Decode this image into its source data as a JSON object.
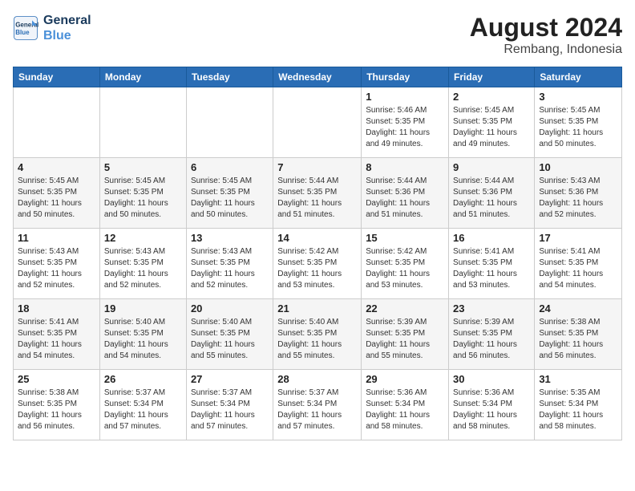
{
  "logo": {
    "line1": "General",
    "line2": "Blue"
  },
  "title": "August 2024",
  "subtitle": "Rembang, Indonesia",
  "days_of_week": [
    "Sunday",
    "Monday",
    "Tuesday",
    "Wednesday",
    "Thursday",
    "Friday",
    "Saturday"
  ],
  "weeks": [
    [
      {
        "day": "",
        "info": ""
      },
      {
        "day": "",
        "info": ""
      },
      {
        "day": "",
        "info": ""
      },
      {
        "day": "",
        "info": ""
      },
      {
        "day": "1",
        "info": "Sunrise: 5:46 AM\nSunset: 5:35 PM\nDaylight: 11 hours\nand 49 minutes."
      },
      {
        "day": "2",
        "info": "Sunrise: 5:45 AM\nSunset: 5:35 PM\nDaylight: 11 hours\nand 49 minutes."
      },
      {
        "day": "3",
        "info": "Sunrise: 5:45 AM\nSunset: 5:35 PM\nDaylight: 11 hours\nand 50 minutes."
      }
    ],
    [
      {
        "day": "4",
        "info": "Sunrise: 5:45 AM\nSunset: 5:35 PM\nDaylight: 11 hours\nand 50 minutes."
      },
      {
        "day": "5",
        "info": "Sunrise: 5:45 AM\nSunset: 5:35 PM\nDaylight: 11 hours\nand 50 minutes."
      },
      {
        "day": "6",
        "info": "Sunrise: 5:45 AM\nSunset: 5:35 PM\nDaylight: 11 hours\nand 50 minutes."
      },
      {
        "day": "7",
        "info": "Sunrise: 5:44 AM\nSunset: 5:35 PM\nDaylight: 11 hours\nand 51 minutes."
      },
      {
        "day": "8",
        "info": "Sunrise: 5:44 AM\nSunset: 5:36 PM\nDaylight: 11 hours\nand 51 minutes."
      },
      {
        "day": "9",
        "info": "Sunrise: 5:44 AM\nSunset: 5:36 PM\nDaylight: 11 hours\nand 51 minutes."
      },
      {
        "day": "10",
        "info": "Sunrise: 5:43 AM\nSunset: 5:36 PM\nDaylight: 11 hours\nand 52 minutes."
      }
    ],
    [
      {
        "day": "11",
        "info": "Sunrise: 5:43 AM\nSunset: 5:35 PM\nDaylight: 11 hours\nand 52 minutes."
      },
      {
        "day": "12",
        "info": "Sunrise: 5:43 AM\nSunset: 5:35 PM\nDaylight: 11 hours\nand 52 minutes."
      },
      {
        "day": "13",
        "info": "Sunrise: 5:43 AM\nSunset: 5:35 PM\nDaylight: 11 hours\nand 52 minutes."
      },
      {
        "day": "14",
        "info": "Sunrise: 5:42 AM\nSunset: 5:35 PM\nDaylight: 11 hours\nand 53 minutes."
      },
      {
        "day": "15",
        "info": "Sunrise: 5:42 AM\nSunset: 5:35 PM\nDaylight: 11 hours\nand 53 minutes."
      },
      {
        "day": "16",
        "info": "Sunrise: 5:41 AM\nSunset: 5:35 PM\nDaylight: 11 hours\nand 53 minutes."
      },
      {
        "day": "17",
        "info": "Sunrise: 5:41 AM\nSunset: 5:35 PM\nDaylight: 11 hours\nand 54 minutes."
      }
    ],
    [
      {
        "day": "18",
        "info": "Sunrise: 5:41 AM\nSunset: 5:35 PM\nDaylight: 11 hours\nand 54 minutes."
      },
      {
        "day": "19",
        "info": "Sunrise: 5:40 AM\nSunset: 5:35 PM\nDaylight: 11 hours\nand 54 minutes."
      },
      {
        "day": "20",
        "info": "Sunrise: 5:40 AM\nSunset: 5:35 PM\nDaylight: 11 hours\nand 55 minutes."
      },
      {
        "day": "21",
        "info": "Sunrise: 5:40 AM\nSunset: 5:35 PM\nDaylight: 11 hours\nand 55 minutes."
      },
      {
        "day": "22",
        "info": "Sunrise: 5:39 AM\nSunset: 5:35 PM\nDaylight: 11 hours\nand 55 minutes."
      },
      {
        "day": "23",
        "info": "Sunrise: 5:39 AM\nSunset: 5:35 PM\nDaylight: 11 hours\nand 56 minutes."
      },
      {
        "day": "24",
        "info": "Sunrise: 5:38 AM\nSunset: 5:35 PM\nDaylight: 11 hours\nand 56 minutes."
      }
    ],
    [
      {
        "day": "25",
        "info": "Sunrise: 5:38 AM\nSunset: 5:35 PM\nDaylight: 11 hours\nand 56 minutes."
      },
      {
        "day": "26",
        "info": "Sunrise: 5:37 AM\nSunset: 5:34 PM\nDaylight: 11 hours\nand 57 minutes."
      },
      {
        "day": "27",
        "info": "Sunrise: 5:37 AM\nSunset: 5:34 PM\nDaylight: 11 hours\nand 57 minutes."
      },
      {
        "day": "28",
        "info": "Sunrise: 5:37 AM\nSunset: 5:34 PM\nDaylight: 11 hours\nand 57 minutes."
      },
      {
        "day": "29",
        "info": "Sunrise: 5:36 AM\nSunset: 5:34 PM\nDaylight: 11 hours\nand 58 minutes."
      },
      {
        "day": "30",
        "info": "Sunrise: 5:36 AM\nSunset: 5:34 PM\nDaylight: 11 hours\nand 58 minutes."
      },
      {
        "day": "31",
        "info": "Sunrise: 5:35 AM\nSunset: 5:34 PM\nDaylight: 11 hours\nand 58 minutes."
      }
    ]
  ]
}
